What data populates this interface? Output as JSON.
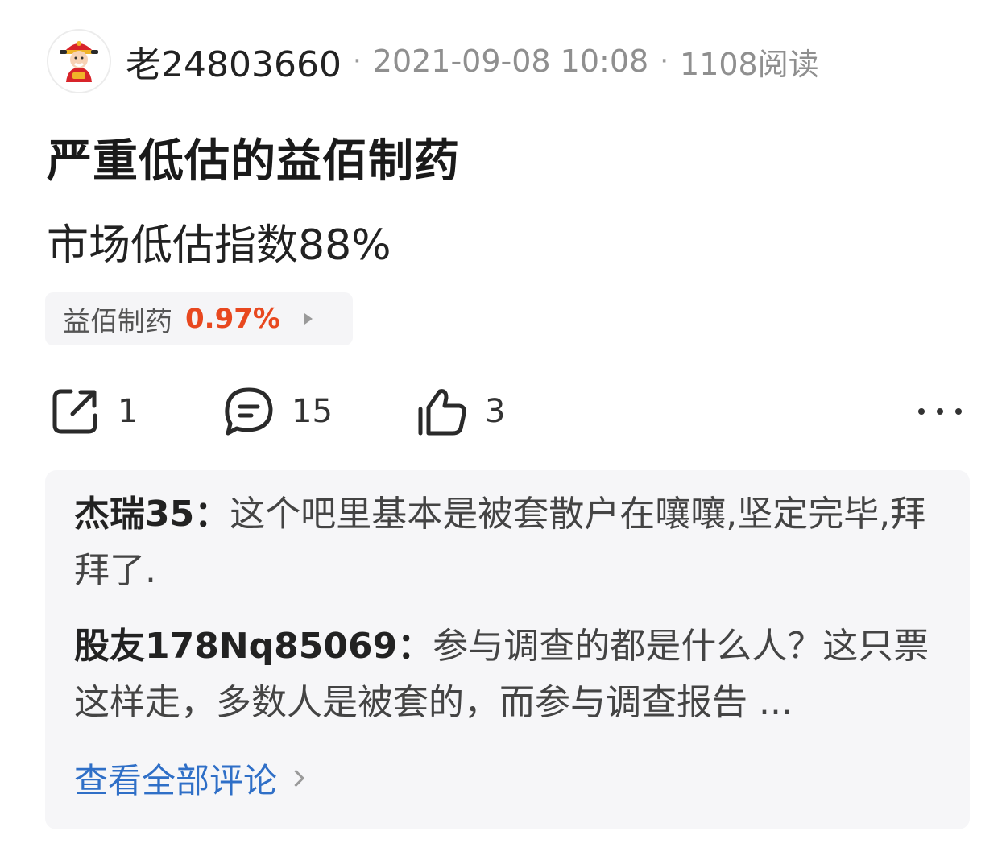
{
  "post": {
    "author": "老24803660",
    "meta_separator": "·",
    "datetime": "2021-09-08 10:08",
    "reads": "1108阅读",
    "title": "严重低估的益佰制药",
    "body": "市场低估指数88%"
  },
  "stock_chip": {
    "name": "益佰制药",
    "change": "0.97%",
    "change_color": "#e8481f"
  },
  "actions": {
    "share_icon": "share-icon",
    "share_count": "1",
    "comment_icon": "comment-icon",
    "comment_count": "15",
    "like_icon": "thumbs-up-icon",
    "like_count": "3",
    "more_icon": "more-dots-icon"
  },
  "comments": {
    "items": [
      {
        "user": "杰瑞35：",
        "text": "这个吧里基本是被套散户在嚷嚷,坚定完毕,拜拜了."
      },
      {
        "user": "股友178Nq85069：",
        "text": "参与调查的都是什么人？这只票这样走，多数人是被套的，而参与调查报告 ..."
      }
    ],
    "view_all": "查看全部评论",
    "link_color": "#2f6fc7"
  }
}
